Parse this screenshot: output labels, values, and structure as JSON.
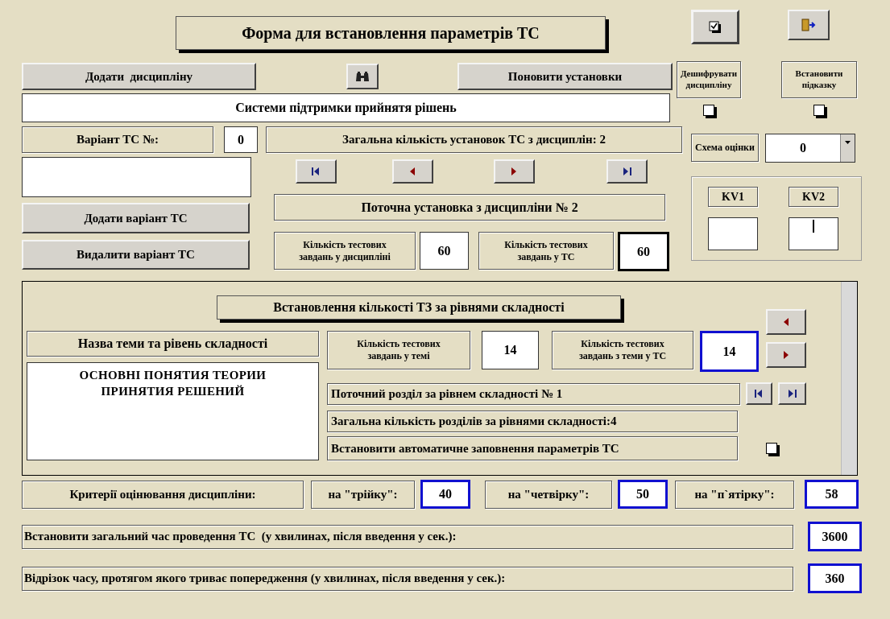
{
  "title": "Форма для встановлення параметрів ТС",
  "add_discipline_button": "Додати  дисципліну",
  "refresh_button": "Поновити установки",
  "toggles": [
    {
      "label": "Дешифрувати дисципліну",
      "checked": false
    },
    {
      "label": "Встановити підказку",
      "checked": false
    }
  ],
  "discipline_name": "Системи підтримки прийнятя рішень",
  "variant_label": "Варіант ТС №:",
  "variant_value": "0",
  "total_settings": "Загальна кількість установок ТС з дисциплін: 2",
  "scheme": {
    "label": "Схема оцінки",
    "value": "0"
  },
  "add_variant_button": "Додати варіант ТС",
  "delete_variant_button": "Видалити варіант ТС",
  "current_setting": "Поточна установка з дисципліни № 2",
  "counts": [
    {
      "label": "Кількість тестових завдань у дисципліні",
      "value": "60",
      "kind": "plain"
    },
    {
      "label": "Кількість тестових завдань у ТС",
      "value": "60",
      "kind": "bold"
    }
  ],
  "kv": [
    {
      "label": "KV1",
      "cursor": false
    },
    {
      "label": "KV2",
      "cursor": true
    }
  ],
  "levels": {
    "title": "Встановлення кількості ТЗ за рівнями складності",
    "topic_label": "Назва теми та рівень складності",
    "topic": "ОСНОВНІ ПОНЯТИЯ ТЕОРИИ ПРИНЯТИЯ РЕШЕНИЙ",
    "counts": [
      {
        "label": "Кількість тестових завдань у темі",
        "value": "14",
        "kind": "plain"
      },
      {
        "label": "Кількість тестових завдань з теми у ТС",
        "value": "14",
        "kind": "focus"
      }
    ],
    "current_section": "Поточний розділ за рівнем складності № 1",
    "total_sections": "Загальна кількість розділів за рівнями складності:4",
    "auto_fill": {
      "label": "Встановити автоматичне заповнення параметрів ТС",
      "checked": false
    }
  },
  "criteria": {
    "label": "Критерії оцінювання дисципліни:",
    "grades": [
      {
        "label": "на \"трійку\":",
        "value": "40",
        "kind": "focus"
      },
      {
        "label": "на \"четвірку\":",
        "value": "50",
        "kind": "focus"
      },
      {
        "label": "на \"п`ятірку\":",
        "value": "58",
        "kind": "focus"
      }
    ]
  },
  "time_rows": [
    {
      "label": "Встановити загальний час проведення ТС  (у хвилинах, після введення у сек.):",
      "value": "3600",
      "kind": "focus"
    },
    {
      "label": "Відрізок часу, протягом якого триває попередження (у хвилинах, після введення у сек.):",
      "value": "360",
      "kind": "focus"
    }
  ]
}
